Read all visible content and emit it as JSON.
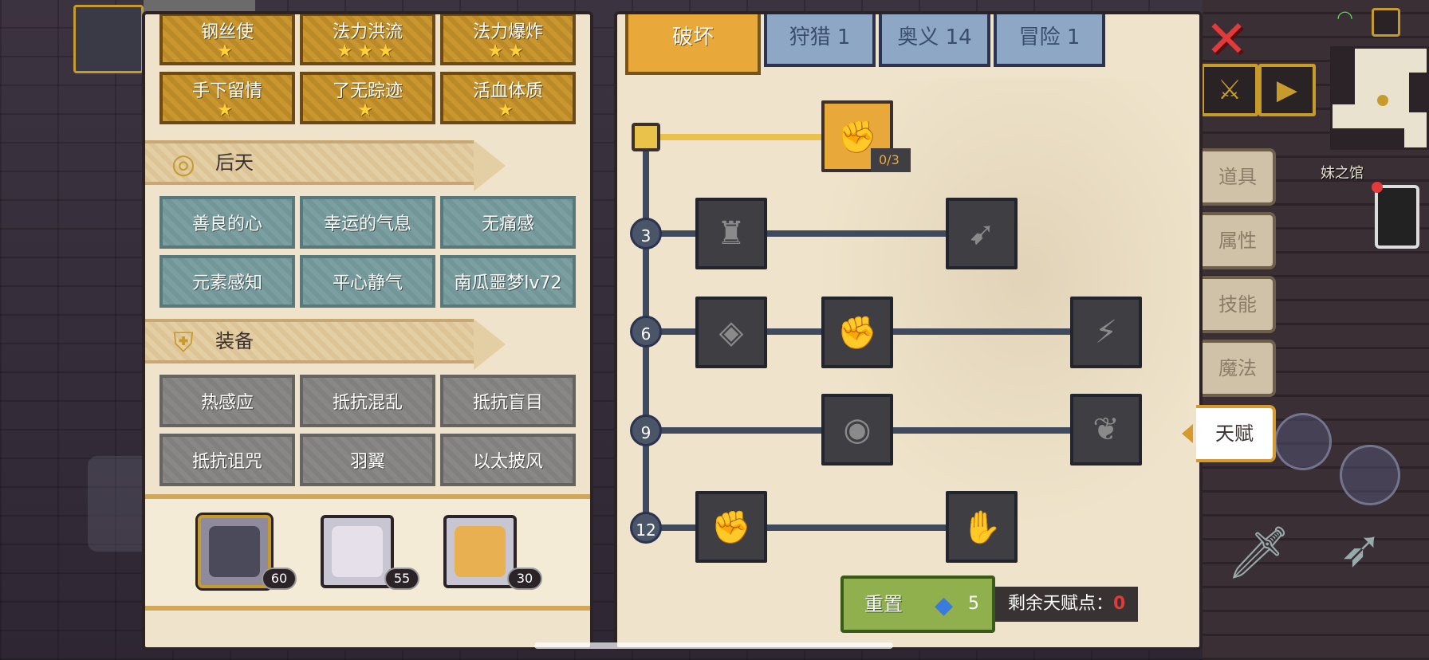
{
  "left_panel": {
    "gold_talents": [
      {
        "label": "钢丝使",
        "stars": "★"
      },
      {
        "label": "法力洪流",
        "stars": "★★★"
      },
      {
        "label": "法力爆炸",
        "stars": "★★"
      },
      {
        "label": "手下留情",
        "stars": "★"
      },
      {
        "label": "了无踪迹",
        "stars": "★"
      },
      {
        "label": "活血体质",
        "stars": "★"
      }
    ],
    "acquired_header": "后天",
    "acquired": [
      "善良的心",
      "幸运的气息",
      "无痛感",
      "元素感知",
      "平心静气",
      "南瓜噩梦lv72"
    ],
    "equipment_header": "装备",
    "equipment": [
      "热感应",
      "抵抗混乱",
      "抵抗盲目",
      "抵抗诅咒",
      "羽翼",
      "以太披风"
    ],
    "companions": [
      {
        "level": "60",
        "selected": true
      },
      {
        "level": "55",
        "selected": false
      },
      {
        "level": "30",
        "selected": false
      }
    ]
  },
  "tabs": [
    "破坏",
    "狩猎 1",
    "奥义 14",
    "冒险 1"
  ],
  "tree": {
    "root_count": "0/3",
    "levels": [
      "3",
      "6",
      "9",
      "12"
    ]
  },
  "side_tabs": [
    "道具",
    "属性",
    "技能",
    "魔法",
    "天赋"
  ],
  "reset": {
    "label": "重置",
    "cost": "5"
  },
  "remaining": {
    "label": "剩余天赋点：",
    "value": "0"
  },
  "scene": {
    "mansion_label": "妹之馆"
  },
  "colors": {
    "accent": "#e9a93a",
    "reset": "#8fb04d",
    "danger": "#e03a3a",
    "teal": "#7c9fa1"
  }
}
